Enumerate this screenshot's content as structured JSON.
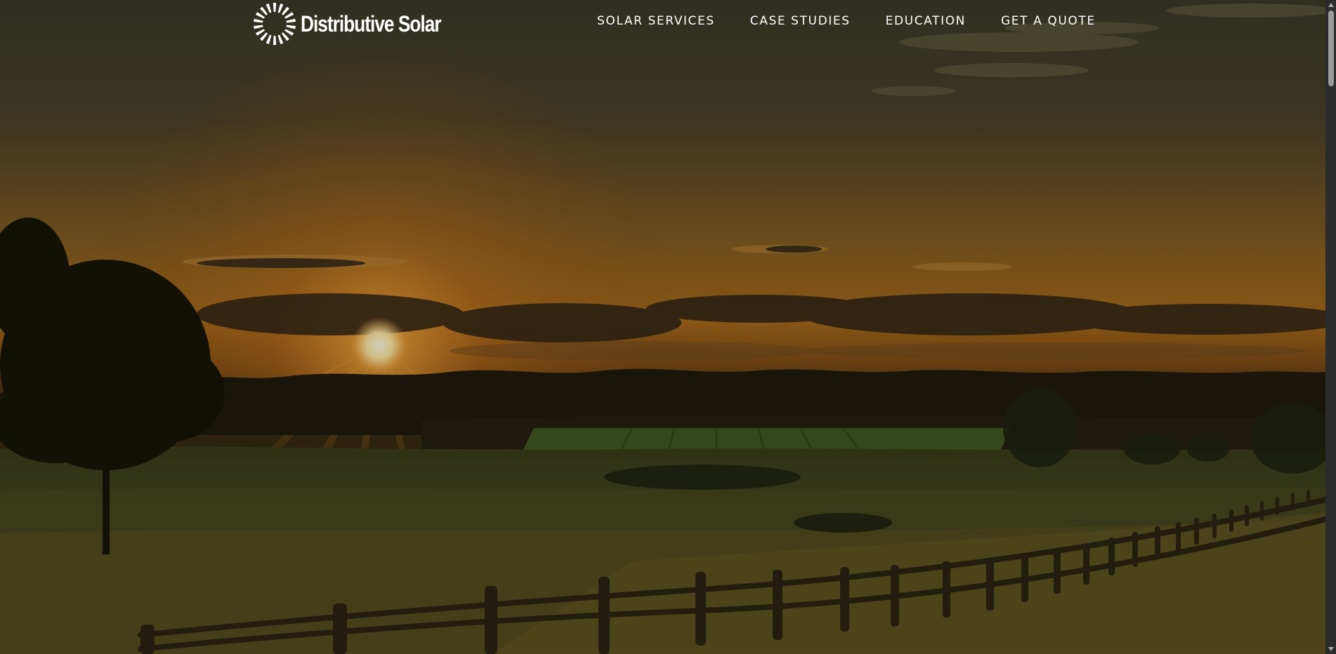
{
  "header": {
    "logo_text": "Distributive Solar",
    "logo_icon": "sun-burst-icon",
    "nav": [
      {
        "label": "SOLAR SERVICES"
      },
      {
        "label": "CASE STUDIES"
      },
      {
        "label": "EDUCATION"
      },
      {
        "label": "GET A QUOTE"
      }
    ]
  },
  "hero": {
    "image_subject": "sunset-over-farm-field-with-fence",
    "colors": {
      "sky_top": "#3d3a27",
      "sky_glow": "#a8681c",
      "sun": "#fff2b8",
      "field": "#3f4420"
    }
  },
  "scrollbar": {
    "up_icon": "chevron-up-icon",
    "down_icon": "chevron-down-icon"
  }
}
